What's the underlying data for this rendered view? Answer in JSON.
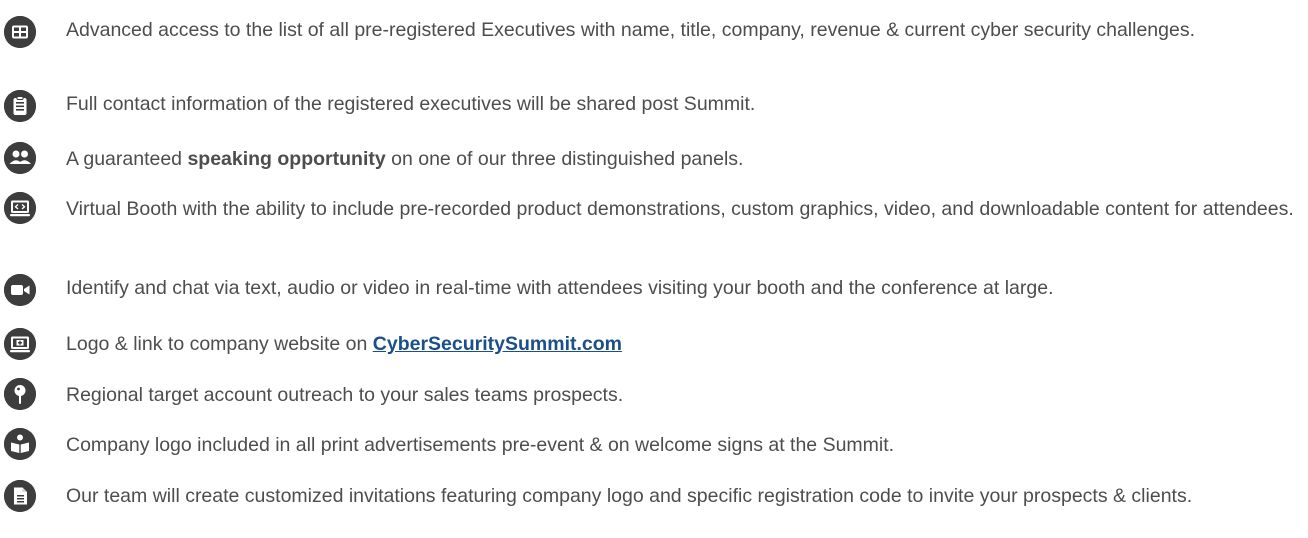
{
  "benefits": [
    {
      "icon": "table-grid-icon",
      "text": "Advanced access to the list of all pre-registered Executives with name, title, company, revenue & current cyber security challenges."
    },
    {
      "icon": "clipboard-list-icon",
      "text": "Full contact information of the registered executives will be shared post Summit."
    },
    {
      "icon": "users-icon",
      "text_before": "A guaranteed ",
      "text_bold": "speaking opportunity",
      "text_after": " on one of our three distinguished panels."
    },
    {
      "icon": "monitor-code-icon",
      "text": "Virtual Booth with the ability to include pre-recorded product demonstrations, custom graphics, video, and downloadable content for attendees."
    },
    {
      "icon": "video-camera-icon",
      "text": "Identify and chat via text, audio or video in real-time with attendees visiting your booth and the conference at large."
    },
    {
      "icon": "monitor-plus-icon",
      "text_before": "Logo & link to company website on ",
      "link_text": "CyberSecuritySummit.com"
    },
    {
      "icon": "map-pin-icon",
      "text": "Regional target account outreach to your sales teams prospects."
    },
    {
      "icon": "reader-book-icon",
      "text": "Company logo included in all print advertisements pre-event & on welcome signs at the Summit."
    },
    {
      "icon": "document-icon",
      "text": "Our team will create customized invitations featuring company logo and specific registration code to invite your prospects & clients."
    }
  ],
  "colors": {
    "text": "#4d4d4d",
    "icon_bg": "#3d3d3d",
    "link": "#1a4f8b"
  }
}
